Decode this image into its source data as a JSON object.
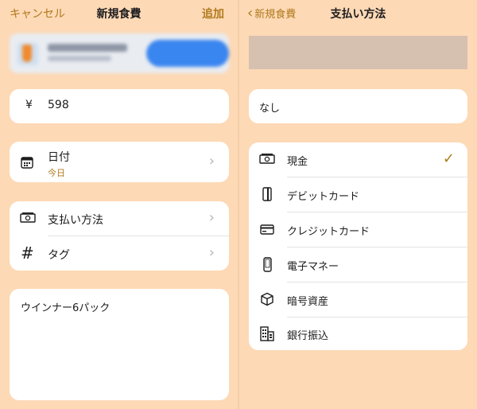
{
  "left": {
    "nav": {
      "cancel": "キャンセル",
      "title": "新規食費",
      "add": "追加"
    },
    "amount": {
      "currency": "¥",
      "value": "598"
    },
    "date": {
      "label": "日付",
      "value": "今日"
    },
    "payment_method": {
      "label": "支払い方法"
    },
    "tag": {
      "label": "タグ"
    },
    "memo": {
      "text": "ウインナー6パック"
    }
  },
  "right": {
    "nav": {
      "back": "新規食費",
      "title": "支払い方法"
    },
    "none_option": "なし",
    "methods": [
      {
        "label": "現金",
        "icon": "cash-icon",
        "selected": true
      },
      {
        "label": "デビットカード",
        "icon": "debit-card-icon",
        "selected": false
      },
      {
        "label": "クレジットカード",
        "icon": "credit-card-icon",
        "selected": false
      },
      {
        "label": "電子マネー",
        "icon": "phone-icon",
        "selected": false
      },
      {
        "label": "暗号資産",
        "icon": "cube-icon",
        "selected": false
      },
      {
        "label": "銀行振込",
        "icon": "bank-building-icon",
        "selected": false
      }
    ],
    "check_mark": "✓"
  },
  "colors": {
    "background": "#fdd9b6",
    "accent": "#b07a1c",
    "card": "#ffffff"
  }
}
